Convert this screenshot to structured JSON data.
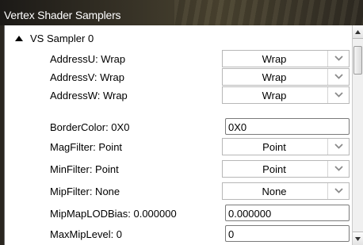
{
  "window": {
    "title": "Vertex Shader Samplers"
  },
  "section": {
    "label": "VS Sampler 0",
    "expanded": true,
    "icon": "collapse-triangle-icon"
  },
  "properties": {
    "address_u": {
      "label": "AddressU: Wrap",
      "value": "Wrap"
    },
    "address_v": {
      "label": "AddressV: Wrap",
      "value": "Wrap"
    },
    "address_w": {
      "label": "AddressW: Wrap",
      "value": "Wrap"
    },
    "border_color": {
      "label": "BorderColor: 0X0",
      "value": "0X0"
    },
    "mag_filter": {
      "label": "MagFilter: Point",
      "value": "Point"
    },
    "min_filter": {
      "label": "MinFilter: Point",
      "value": "Point"
    },
    "mip_filter": {
      "label": "MipFilter: None",
      "value": "None"
    },
    "mip_lod_bias": {
      "label": "MipMapLODBias: 0.000000",
      "value": "0.000000"
    },
    "max_mip_level": {
      "label": "MaxMipLevel: 0",
      "value": "0"
    }
  },
  "colors": {
    "title_bar": "#2e2a22",
    "title_text": "#ffffff",
    "panel_bg": "#ffffff",
    "chevron": "#8a8a8a"
  }
}
